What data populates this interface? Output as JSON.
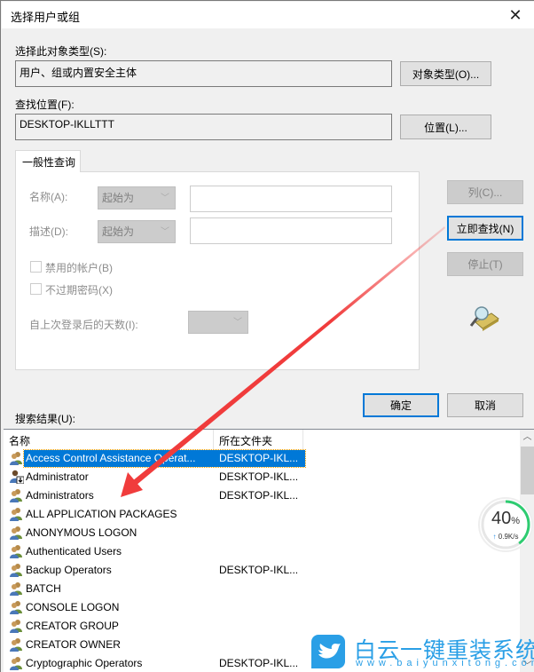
{
  "window": {
    "title": "选择用户或组",
    "close_glyph": "✕"
  },
  "object_type": {
    "label": "选择此对象类型(S):",
    "value": "用户、组或内置安全主体",
    "button": "对象类型(O)..."
  },
  "location": {
    "label": "查找位置(F):",
    "value": "DESKTOP-IKLLTTT",
    "button": "位置(L)..."
  },
  "query_tab": {
    "label": "一般性查询",
    "name_label": "名称(A):",
    "name_mode": "起始为",
    "name_value": "",
    "desc_label": "描述(D):",
    "desc_mode": "起始为",
    "desc_value": "",
    "disabled_accounts_label": "禁用的帐户(B)",
    "disabled_accounts_checked": false,
    "no_expire_label": "不过期密码(X)",
    "no_expire_checked": false,
    "days_label": "自上次登录后的天数(I):",
    "days_value": ""
  },
  "side_buttons": {
    "columns": "列(C)...",
    "find_now": "立即查找(N)",
    "stop": "停止(T)"
  },
  "dialog_buttons": {
    "ok": "确定",
    "cancel": "取消"
  },
  "results": {
    "label": "搜索结果(U):",
    "columns": [
      "名称",
      "所在文件夹"
    ],
    "rows": [
      {
        "name": "Access Control Assistance Operat...",
        "folder": "DESKTOP-IKL...",
        "icon": "group",
        "selected": true
      },
      {
        "name": "Administrator",
        "folder": "DESKTOP-IKL...",
        "icon": "user"
      },
      {
        "name": "Administrators",
        "folder": "DESKTOP-IKL...",
        "icon": "group"
      },
      {
        "name": "ALL APPLICATION PACKAGES",
        "folder": "",
        "icon": "group"
      },
      {
        "name": "ANONYMOUS LOGON",
        "folder": "",
        "icon": "group"
      },
      {
        "name": "Authenticated Users",
        "folder": "",
        "icon": "group"
      },
      {
        "name": "Backup Operators",
        "folder": "DESKTOP-IKL...",
        "icon": "group"
      },
      {
        "name": "BATCH",
        "folder": "",
        "icon": "group"
      },
      {
        "name": "CONSOLE LOGON",
        "folder": "",
        "icon": "group"
      },
      {
        "name": "CREATOR GROUP",
        "folder": "",
        "icon": "group"
      },
      {
        "name": "CREATOR OWNER",
        "folder": "",
        "icon": "group"
      },
      {
        "name": "Cryptographic Operators",
        "folder": "DESKTOP-IKL...",
        "icon": "group"
      }
    ]
  },
  "overlay_gauge": {
    "percent": "40",
    "percent_sign": "%",
    "value_fraction": 0.4,
    "speed": "0.9K/s",
    "speed_arrow": "↑",
    "color": "#2ecc71"
  },
  "watermark": {
    "title": "白云一键重装系统",
    "url": "www.baiyunxitong.com",
    "color": "#2a9fe6"
  },
  "annotation": {
    "arrow_color": "#f03c3c"
  }
}
